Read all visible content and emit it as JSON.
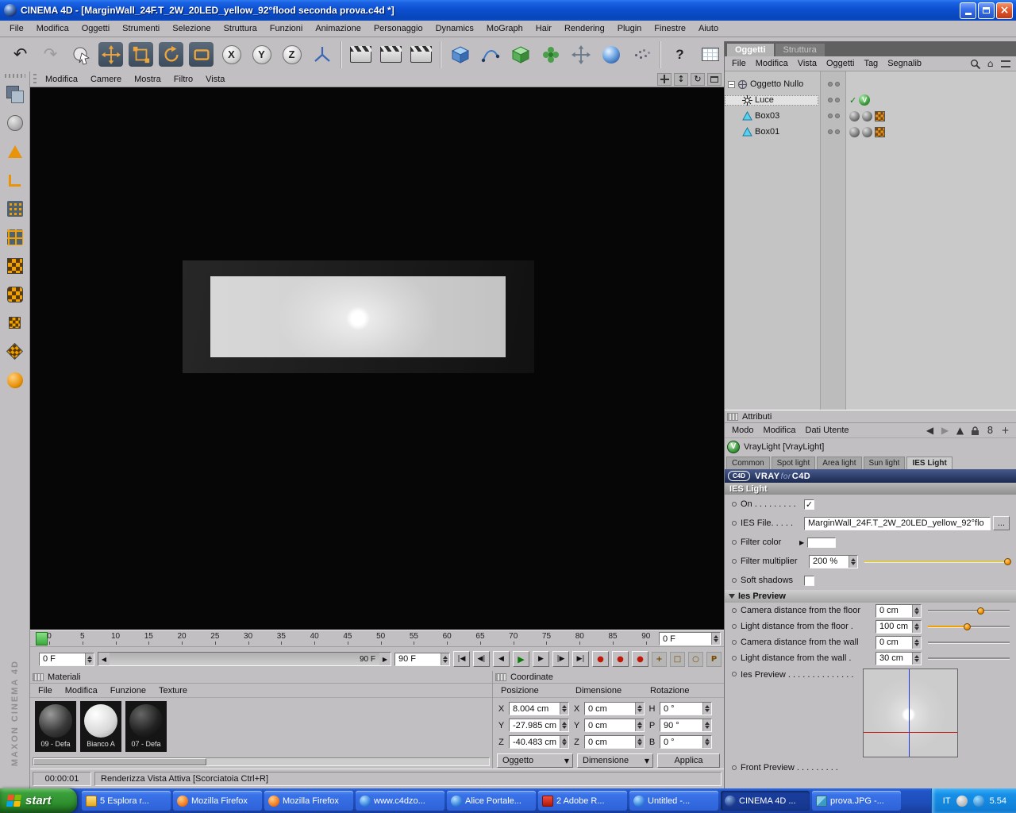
{
  "icons": {
    "undo": "↶",
    "redo": "↷",
    "close": "×",
    "home": "⌂",
    "minus": "−",
    "plus": "+",
    "check": "✓",
    "question": "?",
    "tri_left": "◀",
    "tri_right": "▶",
    "tri_up": "▲",
    "tri_down": "▼",
    "goto_start": "|◀",
    "prev_key": "◀|",
    "prev_frame": "◀",
    "play": "▶",
    "next_frame": "▶",
    "next_key": "|▶",
    "goto_end": "▶|",
    "record": "●",
    "updown": "↕",
    "rotate": "↻",
    "square": "□",
    "circle": "○",
    "param": "P",
    "dot": "·",
    "magnet": "U",
    "vray_v": "V",
    "x": "X",
    "y": "Y",
    "z": "Z"
  },
  "window": {
    "title": "CINEMA 4D - [MarginWall_24F.T_2W_20LED_yellow_92°flood seconda prova.c4d *]"
  },
  "menubar": {
    "items": [
      "File",
      "Modifica",
      "Oggetti",
      "Strumenti",
      "Selezione",
      "Struttura",
      "Funzioni",
      "Animazione",
      "Personaggio",
      "Dynamics",
      "MoGraph",
      "Hair",
      "Rendering",
      "Plugin",
      "Finestre",
      "Aiuto"
    ]
  },
  "toolbar": {
    "axis_locks": [
      "X",
      "Y",
      "Z"
    ]
  },
  "viewport": {
    "menu": [
      "Modifica",
      "Camere",
      "Mostra",
      "Filtro",
      "Vista"
    ]
  },
  "timeline": {
    "ticks": [
      "0",
      "5",
      "10",
      "15",
      "20",
      "25",
      "30",
      "35",
      "40",
      "45",
      "50",
      "55",
      "60",
      "65",
      "70",
      "75",
      "80",
      "85",
      "90"
    ],
    "current_frame": "0 F",
    "loop_start": "0 F",
    "slider_end_label": "90 F",
    "loop_end": "90 F"
  },
  "materials": {
    "title": "Materiali",
    "menu": [
      "File",
      "Modifica",
      "Funzione",
      "Texture"
    ],
    "items": [
      {
        "name": "09 - Defa"
      },
      {
        "name": "Bianco A"
      },
      {
        "name": "07 - Defa"
      }
    ]
  },
  "coordinates": {
    "title": "Coordinate",
    "tabs": [
      "Posizione",
      "Dimensione",
      "Rotazione"
    ],
    "pos": {
      "x_label": "X",
      "x": "8.004 cm",
      "y_label": "Y",
      "y": "-27.985 cm",
      "z_label": "Z",
      "z": "-40.483 cm"
    },
    "dim": {
      "x_label": "X",
      "x": "0 cm",
      "y_label": "Y",
      "y": "0 cm",
      "z_label": "Z",
      "z": "0 cm"
    },
    "rot": {
      "h_label": "H",
      "h": "0 °",
      "p_label": "P",
      "p": "90 °",
      "b_label": "B",
      "b": "0 °"
    },
    "object_select": "Oggetto",
    "dimension_select": "Dimensione",
    "apply": "Applica"
  },
  "object_manager": {
    "tabs": [
      "Oggetti",
      "Struttura"
    ],
    "menu": [
      "File",
      "Modifica",
      "Vista",
      "Oggetti",
      "Tag",
      "Segnalib"
    ],
    "tree": [
      {
        "label": "Oggetto Nullo"
      },
      {
        "label": "Luce"
      },
      {
        "label": "Box03"
      },
      {
        "label": "Box01"
      }
    ]
  },
  "attributes": {
    "panel_title": "Attributi",
    "menu": [
      "Modo",
      "Modifica",
      "Dati Utente"
    ],
    "history_count": "8",
    "object_title": "VrayLight [VrayLight]",
    "tabs": [
      "Common",
      "Spot light",
      "Area light",
      "Sun light",
      "IES Light"
    ],
    "banner": {
      "vray": "VRAY",
      "for": "for",
      "c4d": "C4D",
      "logo": "C4D"
    },
    "section": "IES Light",
    "on_label": "On . . . . . . . . .",
    "ies_file_label": "IES File. . . . .",
    "ies_file_value": "MarginWall_24F.T_2W_20LED_yellow_92°flo",
    "browse_label": "...",
    "filter_color_label": "Filter color",
    "filter_color_hex": "#ffffff",
    "filter_multiplier_label": "Filter multiplier",
    "filter_multiplier_value": "200 %",
    "soft_shadows_label": "Soft shadows",
    "preview_section": "Ies Preview",
    "cam_floor_label": "Camera distance from the floor",
    "cam_floor_value": "0 cm",
    "light_floor_label": "Light distance from the floor .",
    "light_floor_value": "100 cm",
    "cam_wall_label": "Camera distance from the wall",
    "cam_wall_value": "0 cm",
    "light_wall_label": "Light distance from the wall .",
    "light_wall_value": "30 cm",
    "ies_preview_label": "Ies Preview . . . . . . . . . . . . . .",
    "front_preview_label": "Front Preview . . . . . . . . ."
  },
  "statusbar": {
    "time": "00:00:01",
    "message": "Renderizza Vista Attiva [Scorciatoia Ctrl+R]"
  },
  "branding": {
    "vertical_logo": "MAXON CINEMA 4D"
  },
  "taskbar": {
    "start_label": "start",
    "items": [
      {
        "label": "5 Esplora r..."
      },
      {
        "label": "Mozilla Firefox"
      },
      {
        "label": "Mozilla Firefox"
      },
      {
        "label": "www.c4dzo..."
      },
      {
        "label": "Alice Portale..."
      },
      {
        "label": "2 Adobe R..."
      },
      {
        "label": "Untitled -..."
      },
      {
        "label": "CINEMA 4D ..."
      },
      {
        "label": "prova.JPG -..."
      }
    ],
    "tray": {
      "lang": "IT",
      "clock": "5.54"
    }
  }
}
